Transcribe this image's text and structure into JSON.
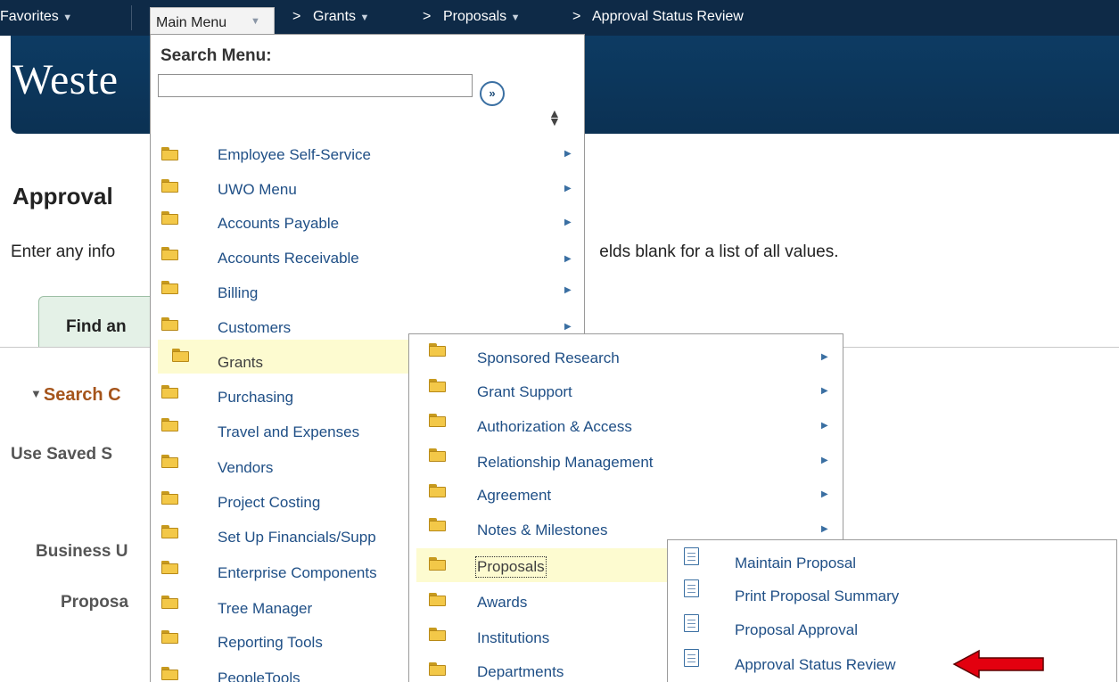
{
  "topnav": {
    "favorites": "Favorites",
    "main_menu": "Main Menu",
    "breadcrumbs": [
      {
        "label": "Grants",
        "has_caret": true
      },
      {
        "label": "Proposals",
        "has_caret": true
      },
      {
        "label": "Approval Status Review",
        "has_caret": false
      }
    ]
  },
  "banner": {
    "text": "Weste"
  },
  "page": {
    "title": "Approval",
    "instructions": "Enter any info",
    "instructions_tail": "elds blank for a list of all values.",
    "tab_find": "Find an",
    "search_criteria": "Search C",
    "saved_search": "Use Saved S",
    "business_unit": "Business U",
    "proposal": "Proposa"
  },
  "main_menu": {
    "search_label": "Search Menu:",
    "search_value": "",
    "go_icon": "double-chevron-right-icon",
    "items": [
      {
        "label": "Employee Self-Service",
        "submenu": true
      },
      {
        "label": "UWO Menu",
        "submenu": true
      },
      {
        "label": "Accounts Payable",
        "submenu": true
      },
      {
        "label": "Accounts Receivable",
        "submenu": true
      },
      {
        "label": "Billing",
        "submenu": true
      },
      {
        "label": "Customers",
        "submenu": true
      },
      {
        "label": "Grants",
        "submenu": true,
        "highlighted": true
      },
      {
        "label": "Purchasing",
        "submenu": true
      },
      {
        "label": "Travel and Expenses",
        "submenu": true
      },
      {
        "label": "Vendors",
        "submenu": true
      },
      {
        "label": "Project Costing",
        "submenu": true
      },
      {
        "label": "Set Up Financials/Supp",
        "submenu": true
      },
      {
        "label": "Enterprise Components",
        "submenu": true
      },
      {
        "label": "Tree Manager",
        "submenu": true
      },
      {
        "label": "Reporting Tools",
        "submenu": true
      },
      {
        "label": "PeopleTools",
        "submenu": true
      }
    ]
  },
  "grants_menu": {
    "items": [
      {
        "label": "Sponsored Research",
        "submenu": true
      },
      {
        "label": "Grant Support",
        "submenu": true
      },
      {
        "label": "Authorization & Access",
        "submenu": true
      },
      {
        "label": "Relationship Management",
        "submenu": true
      },
      {
        "label": "Agreement",
        "submenu": true
      },
      {
        "label": "Notes & Milestones",
        "submenu": true
      },
      {
        "label": "Proposals",
        "submenu": true,
        "highlighted": true
      },
      {
        "label": "Awards",
        "submenu": true
      },
      {
        "label": "Institutions",
        "submenu": true
      },
      {
        "label": "Departments",
        "submenu": true
      }
    ]
  },
  "proposals_menu": {
    "items": [
      {
        "label": "Maintain Proposal"
      },
      {
        "label": "Print Proposal Summary"
      },
      {
        "label": "Proposal Approval"
      },
      {
        "label": "Approval Status Review",
        "annotated": true
      }
    ]
  },
  "colors": {
    "topbar": "#0e2a47",
    "banner": "#0d3b63",
    "link": "#1f4f86",
    "highlight": "#fdfbd0",
    "annotation_arrow": "#e3000f"
  }
}
